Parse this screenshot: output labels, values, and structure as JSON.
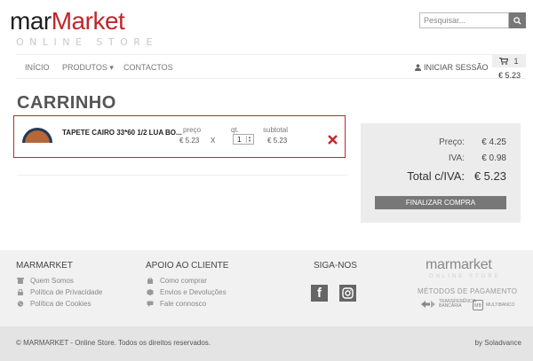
{
  "brand": {
    "logo_part1": "mar",
    "logo_part2": "Market",
    "tagline": "ONLINE STORE"
  },
  "search": {
    "placeholder": "Pesquisar...",
    "icon": "search-icon"
  },
  "nav": {
    "items": [
      {
        "label": "INÍCIO"
      },
      {
        "label": "PRODUTOS ▾"
      },
      {
        "label": "CONTACTOS"
      }
    ],
    "login_label": "INICIAR SESSÃO"
  },
  "cart_widget": {
    "count": "1",
    "total": "€ 5.23"
  },
  "page": {
    "title": "CARRINHO"
  },
  "cart_items": [
    {
      "name": "TAPETE CAIRO 33*60 1/2 LUA BO...",
      "price_label": "preço",
      "price": "€ 5.23",
      "times": "X",
      "qty_label": "qt.",
      "qty": "1",
      "subtotal_label": "subtotal",
      "subtotal": "€ 5.23"
    }
  ],
  "summary": {
    "price_label": "Preço:",
    "price_value": "€ 4.25",
    "vat_label": "IVA:",
    "vat_value": "€ 0.98",
    "total_label": "Total c/IVA:",
    "total_value": "€ 5.23",
    "checkout_label": "FINALIZAR COMPRA"
  },
  "footer": {
    "col1": {
      "heading": "MARMARKET",
      "links": [
        {
          "label": "Quem Somos",
          "icon": "building-icon"
        },
        {
          "label": "Política de Privacidade",
          "icon": "lock-icon"
        },
        {
          "label": "Política de Cookies",
          "icon": "cookie-icon"
        }
      ]
    },
    "col2": {
      "heading": "APOIO AO CLIENTE",
      "links": [
        {
          "label": "Como comprar",
          "icon": "bag-icon"
        },
        {
          "label": "Envios e Devoluções",
          "icon": "box-icon"
        },
        {
          "label": "Fale connosco",
          "icon": "chat-icon"
        }
      ]
    },
    "col3": {
      "heading": "SIGA-NOS",
      "facebook_glyph": "f"
    },
    "brand": {
      "logo": "marmarket",
      "tagline": "ONLINE STORE"
    },
    "payments": {
      "heading": "MÉTODOS DE PAGAMENTO",
      "methods": [
        {
          "label": "TRANSFERÊNCIA BANCÁRIA"
        },
        {
          "label": "MULTIBANCO"
        }
      ]
    }
  },
  "bottom": {
    "copyright": "© MARMARKET - Online Store. Todos os direitos reservados.",
    "credit": "by Soladvance"
  },
  "colors": {
    "brand_red": "#c0262b",
    "dark": "#1f1f1f",
    "button_gray": "#777777"
  }
}
